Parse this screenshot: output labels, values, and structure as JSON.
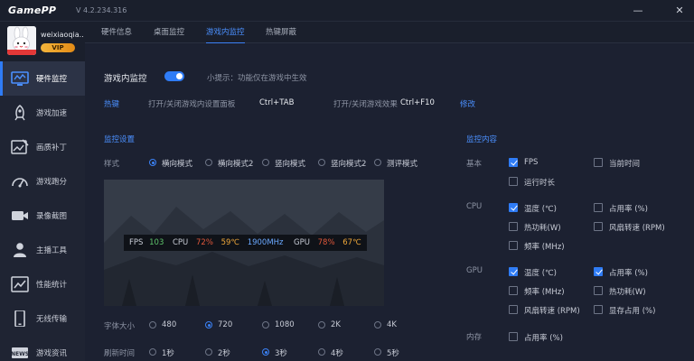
{
  "app": {
    "logo": "GamePP",
    "version": "V 4.2.234.316"
  },
  "window_controls": {
    "minimize": "—",
    "close": "✕"
  },
  "user": {
    "name": "weixiaoqia...",
    "badge": "VIP"
  },
  "sidebar": {
    "items": [
      {
        "label": "硬件监控"
      },
      {
        "label": "游戏加速"
      },
      {
        "label": "画质补丁"
      },
      {
        "label": "游戏跑分"
      },
      {
        "label": "录像截图"
      },
      {
        "label": "主播工具"
      },
      {
        "label": "性能统计"
      },
      {
        "label": "无线传输"
      },
      {
        "label": "游戏资讯"
      }
    ]
  },
  "tabs": [
    {
      "label": "硬件信息"
    },
    {
      "label": "桌面监控"
    },
    {
      "label": "游戏内监控"
    },
    {
      "label": "热键屏蔽"
    }
  ],
  "monitor": {
    "title": "游戏内监控",
    "tip": "小提示：功能仅在游戏中生效",
    "hotkey_label": "热键",
    "hotkey1_desc": "打开/关闭游戏内设置面板",
    "hotkey1_value": "Ctrl+TAB",
    "hotkey2_desc": "打开/关闭游戏效果",
    "hotkey2_value": "Ctrl+F10",
    "edit": "修改"
  },
  "settings": {
    "title": "监控设置",
    "style_label": "样式",
    "styles": [
      "横向模式",
      "横向模式2",
      "竖向模式",
      "竖向模式2",
      "测评模式"
    ],
    "font_label": "字体大小",
    "font_sizes": [
      "480",
      "720",
      "1080",
      "2K",
      "4K"
    ],
    "refresh_label": "刷新时间",
    "refresh_options": [
      "1秒",
      "2秒",
      "3秒",
      "4秒",
      "5秒"
    ]
  },
  "overlay": {
    "fps_label": "FPS",
    "fps_value": "103",
    "cpu_label": "CPU",
    "cpu_usage": "72%",
    "cpu_temp": "59℃",
    "cpu_freq": "1900MHz",
    "gpu_label": "GPU",
    "gpu_usage": "78%",
    "gpu_temp": "67℃"
  },
  "content_panel": {
    "title": "监控内容",
    "basic_label": "基本",
    "basic_items": [
      "FPS",
      "当前时间",
      "运行时长"
    ],
    "cpu_label": "CPU",
    "cpu_items": [
      "温度 (℃)",
      "占用率 (%)",
      "热功耗(W)",
      "风扇转速 (RPM)",
      "频率 (MHz)"
    ],
    "gpu_label": "GPU",
    "gpu_items": [
      "温度 (℃)",
      "占用率 (%)",
      "频率 (MHz)",
      "热功耗(W)",
      "风扇转速 (RPM)",
      "显存占用 (%)"
    ],
    "mem_label": "内存",
    "mem_items": [
      "占用率 (%)"
    ]
  },
  "colors": {
    "accent": "#2f7cf6",
    "fps_value": "#5ec46b",
    "cpu_value": "#e0573a",
    "temp_value": "#f0a83a",
    "freq_value": "#6aa8ff"
  }
}
